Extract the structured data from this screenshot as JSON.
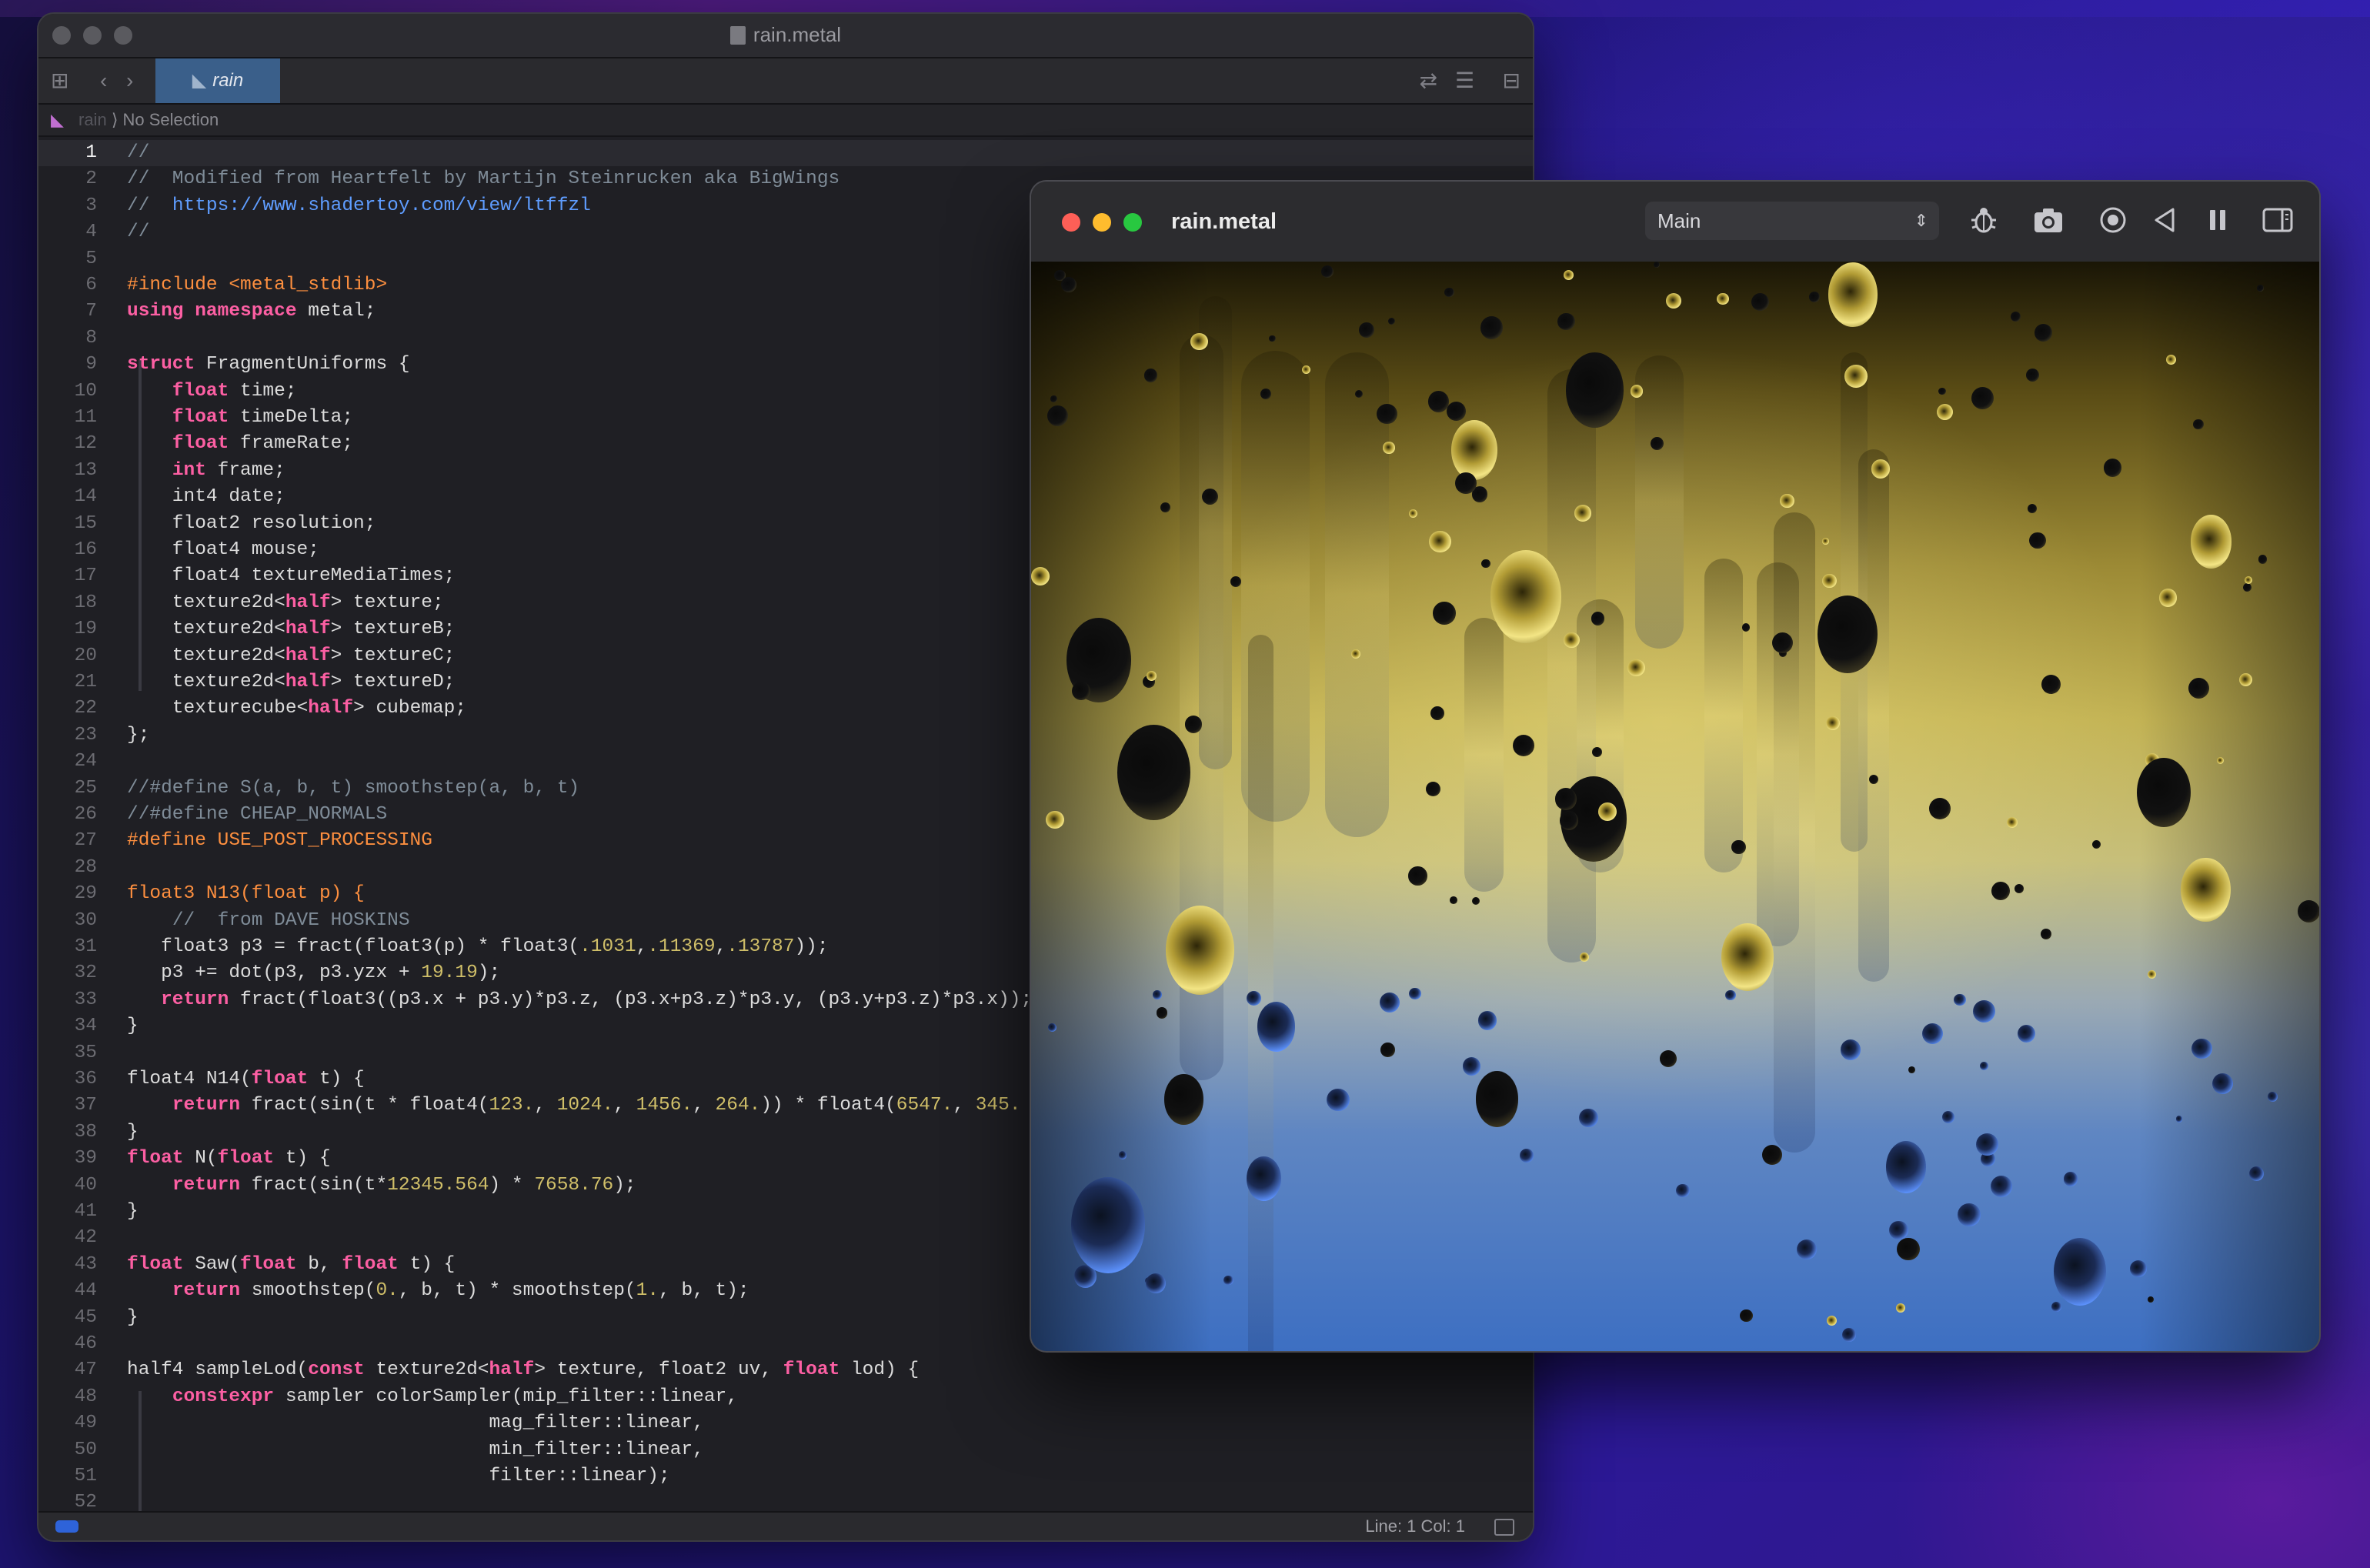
{
  "editor": {
    "window_title": "rain.metal",
    "tab_label": "rain",
    "breadcrumb": {
      "file": "rain",
      "selection": "No Selection"
    },
    "current_line": 1,
    "status": {
      "position": "Line: 1  Col: 1"
    },
    "toolbar_icons": [
      "grid-icon",
      "back-chevron-icon",
      "forward-chevron-icon",
      "swap-arrows-icon",
      "minimap-icon",
      "split-editor-icon"
    ],
    "lines": [
      {
        "n": "1",
        "html": "<span class='cm'>//</span>"
      },
      {
        "n": "2",
        "html": "<span class='cm'>//  Modified from Heartfelt by Martijn Steinrucken aka BigWings</span>"
      },
      {
        "n": "3",
        "html": "<span class='cm'>//  </span><span class='url'>https://www.shadertoy.com/view/ltffzl</span>"
      },
      {
        "n": "4",
        "html": "<span class='cm'>//</span>"
      },
      {
        "n": "5",
        "html": ""
      },
      {
        "n": "6",
        "html": "<span class='pp'>#include &lt;metal_stdlib&gt;</span>"
      },
      {
        "n": "7",
        "html": "<span class='kw'>using namespace</span> metal;"
      },
      {
        "n": "8",
        "html": ""
      },
      {
        "n": "9",
        "html": "<span class='kw'>struct</span> FragmentUniforms {"
      },
      {
        "n": "10",
        "html": "    <span class='kw'>float</span> time;"
      },
      {
        "n": "11",
        "html": "    <span class='kw'>float</span> timeDelta;"
      },
      {
        "n": "12",
        "html": "    <span class='kw'>float</span> frameRate;"
      },
      {
        "n": "13",
        "html": "    <span class='kw'>int</span> frame;"
      },
      {
        "n": "14",
        "html": "    int4 date;"
      },
      {
        "n": "15",
        "html": "    float2 resolution;"
      },
      {
        "n": "16",
        "html": "    float4 mouse;"
      },
      {
        "n": "17",
        "html": "    float4 textureMediaTimes;"
      },
      {
        "n": "18",
        "html": "    texture2d&lt;<span class='kw'>half</span>&gt; texture;"
      },
      {
        "n": "19",
        "html": "    texture2d&lt;<span class='kw'>half</span>&gt; textureB;"
      },
      {
        "n": "20",
        "html": "    texture2d&lt;<span class='kw'>half</span>&gt; textureC;"
      },
      {
        "n": "21",
        "html": "    texture2d&lt;<span class='kw'>half</span>&gt; textureD;"
      },
      {
        "n": "22",
        "html": "    texturecube&lt;<span class='kw'>half</span>&gt; cubemap;"
      },
      {
        "n": "23",
        "html": "};"
      },
      {
        "n": "24",
        "html": ""
      },
      {
        "n": "25",
        "html": "<span class='cm'>//#define S(a, b, t) smoothstep(a, b, t)</span>"
      },
      {
        "n": "26",
        "html": "<span class='cm'>//#define CHEAP_NORMALS</span>"
      },
      {
        "n": "27",
        "html": "<span class='pp'>#define USE_POST_PROCESSING</span>"
      },
      {
        "n": "28",
        "html": ""
      },
      {
        "n": "29",
        "html": "<span class='pp'>float3 N13(</span><span class='pp'>float p) {</span>"
      },
      {
        "n": "30",
        "html": "    <span class='cm'>//  from DAVE HOSKINS</span>"
      },
      {
        "n": "31",
        "html": "   float3 p3 = fract(float3(p) * float3(<span class='num'>.1031</span>,<span class='num'>.11369</span>,<span class='num'>.13787</span>));"
      },
      {
        "n": "32",
        "html": "   p3 += dot(p3, p3.yzx + <span class='num'>19.19</span>);"
      },
      {
        "n": "33",
        "html": "   <span class='kw'>return</span> fract(float3((p3.x + p3.y)*p3.z, (p3.x+p3.z)*p3.y, (p3.y+p3.z)*p3.x));"
      },
      {
        "n": "34",
        "html": "}"
      },
      {
        "n": "35",
        "html": ""
      },
      {
        "n": "36",
        "html": "float4 N14(<span class='kw'>float</span> t) {"
      },
      {
        "n": "37",
        "html": "    <span class='kw'>return</span> fract(sin(t * float4(<span class='num'>123.</span>, <span class='num'>1024.</span>, <span class='num'>1456.</span>, <span class='num'>264.</span>)) * float4(<span class='num'>6547.</span>, <span class='num'>345.</span>"
      },
      {
        "n": "38",
        "html": "}"
      },
      {
        "n": "39",
        "html": "<span class='kw'>float</span> N(<span class='kw'>float</span> t) {"
      },
      {
        "n": "40",
        "html": "    <span class='kw'>return</span> fract(sin(t*<span class='num'>12345.564</span>) * <span class='num'>7658.76</span>);"
      },
      {
        "n": "41",
        "html": "}"
      },
      {
        "n": "42",
        "html": ""
      },
      {
        "n": "43",
        "html": "<span class='kw'>float</span> Saw(<span class='kw'>float</span> b, <span class='kw'>float</span> t) {"
      },
      {
        "n": "44",
        "html": "    <span class='kw'>return</span> smoothstep(<span class='num'>0.</span>, b, t) * smoothstep(<span class='num'>1.</span>, b, t);"
      },
      {
        "n": "45",
        "html": "}"
      },
      {
        "n": "46",
        "html": ""
      },
      {
        "n": "47",
        "html": "half4 sampleLod(<span class='kw'>const</span> texture2d&lt;<span class='kw'>half</span>&gt; texture, float2 uv, <span class='kw'>float</span> lod) {"
      },
      {
        "n": "48",
        "html": "    <span class='kw'>constexpr</span> sampler colorSampler(mip_filter::linear,"
      },
      {
        "n": "49",
        "html": "                                mag_filter::linear,"
      },
      {
        "n": "50",
        "html": "                                min_filter::linear,"
      },
      {
        "n": "51",
        "html": "                                filter::linear);"
      },
      {
        "n": "52",
        "html": ""
      }
    ]
  },
  "preview": {
    "window_title": "rain.metal",
    "scene_select": {
      "value": "Main",
      "chevron": "up-down-chevron-icon"
    },
    "buttons": [
      "debug-bug-icon",
      "camera-icon",
      "record-icon",
      "rewind-icon",
      "pause-icon",
      "sidebar-icon"
    ],
    "colors": {
      "close": "#fe5f57",
      "minimize": "#febc2e",
      "zoom": "#28c840"
    }
  }
}
